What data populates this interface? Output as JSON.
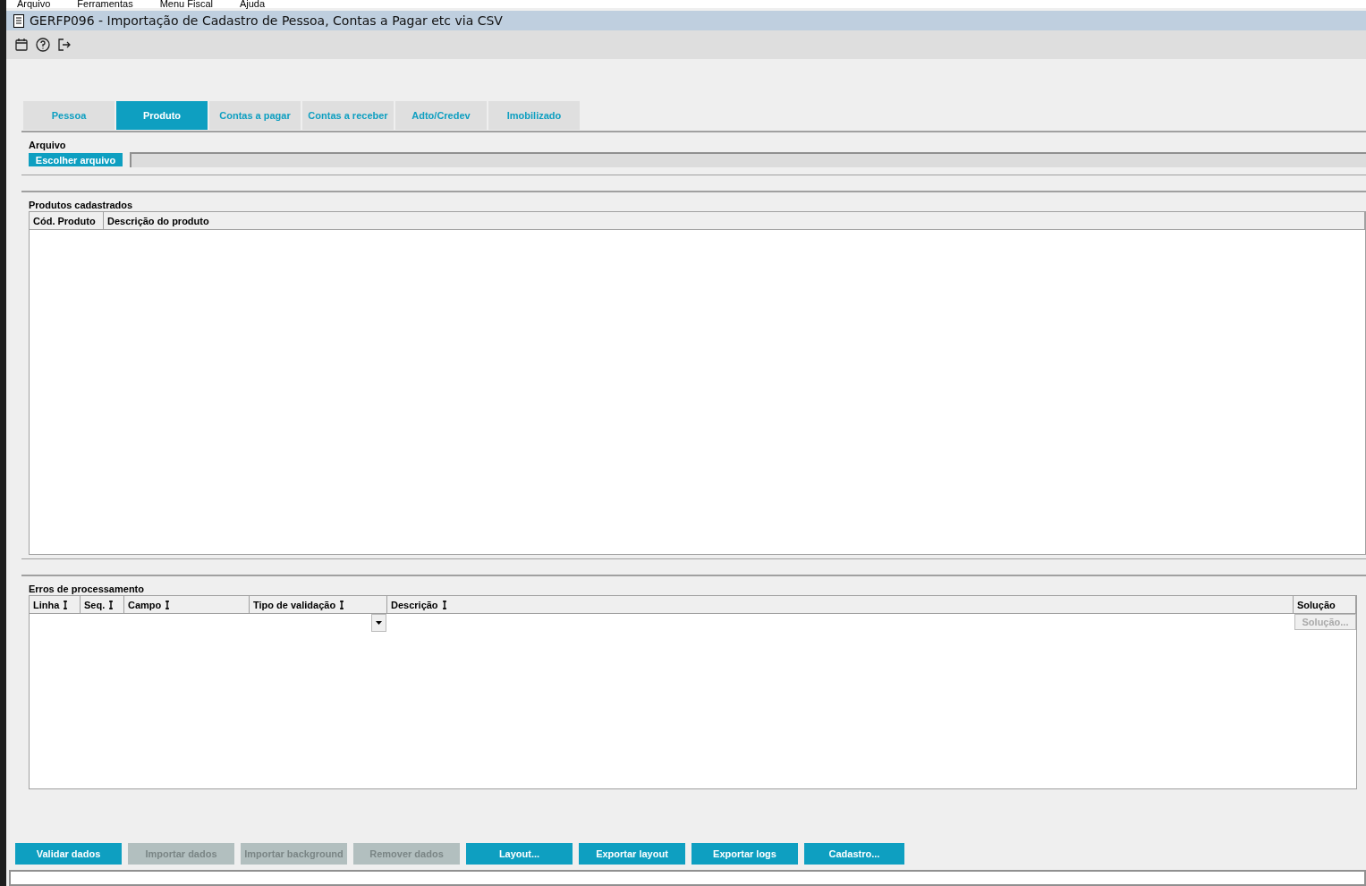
{
  "menu": [
    "Arquivo",
    "Ferramentas",
    "Menu Fiscal",
    "Ajuda"
  ],
  "window": {
    "title": "GERFP096 - Importação de Cadastro de Pessoa, Contas a Pagar etc via CSV"
  },
  "tabs": [
    {
      "label": "Pessoa",
      "selected": false
    },
    {
      "label": "Produto",
      "selected": true
    },
    {
      "label": "Contas a pagar",
      "selected": false
    },
    {
      "label": "Contas a receber",
      "selected": false
    },
    {
      "label": "Adto/Credev",
      "selected": false
    },
    {
      "label": "Imobilizado",
      "selected": false
    }
  ],
  "arquivo": {
    "label": "Arquivo",
    "button": "Escolher arquivo"
  },
  "produtos": {
    "title": "Produtos cadastrados",
    "columns": [
      "Cód. Produto",
      "Descrição do produto"
    ]
  },
  "erros": {
    "title": "Erros de processamento",
    "columns": [
      {
        "label": "Linha",
        "sortable": true
      },
      {
        "label": "Seq.",
        "sortable": true
      },
      {
        "label": "Campo",
        "sortable": true
      },
      {
        "label": "Tipo de validação",
        "sortable": true
      },
      {
        "label": "Descrição",
        "sortable": true
      },
      {
        "label": "Solução",
        "sortable": false
      }
    ],
    "solution_button": {
      "label": "Solução...",
      "disabled": true
    }
  },
  "buttons": [
    {
      "label": "Validar dados",
      "disabled": false
    },
    {
      "label": "Importar dados",
      "disabled": true
    },
    {
      "label": "Importar background",
      "disabled": true
    },
    {
      "label": "Remover dados",
      "disabled": true
    },
    {
      "label": "Layout...",
      "disabled": false
    },
    {
      "label": "Exportar layout",
      "disabled": false
    },
    {
      "label": "Exportar logs",
      "disabled": false
    },
    {
      "label": "Cadastro...",
      "disabled": false
    }
  ]
}
